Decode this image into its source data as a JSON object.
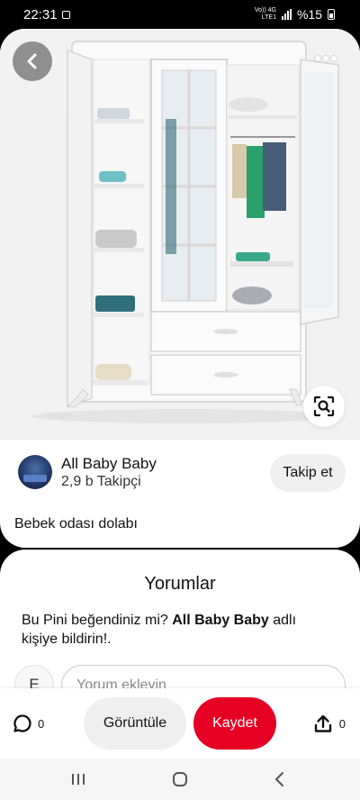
{
  "status_bar": {
    "time": "22:31",
    "network_top": "Vo)) 4G",
    "network_bottom": "LTE1",
    "battery": "%15"
  },
  "pin": {
    "image_alt": "white wardrobe",
    "creator": {
      "name": "All Baby Baby",
      "followers": "2,9 b Takipçi",
      "follow_label": "Takip et"
    },
    "description": "Bebek odası dolabı"
  },
  "comments": {
    "title": "Yorumlar",
    "prompt_before": "Bu Pini beğendiniz mi? ",
    "prompt_bold": "All Baby Baby",
    "prompt_after": " adlı kişiye bildirin!.",
    "avatar_initial": "E",
    "input_placeholder": "Yorum ekleyin"
  },
  "actions": {
    "comment_count": "0",
    "view_label": "Görüntüle",
    "save_label": "Kaydet",
    "share_count": "0"
  },
  "icons": {
    "back": "chevron-left-icon",
    "more": "more-dots-icon",
    "lens": "visual-search-icon",
    "comment": "speech-bubble-icon",
    "share": "share-icon",
    "recents": "recents-icon",
    "home": "home-icon",
    "nav_back": "nav-back-icon"
  },
  "colors": {
    "brand_red": "#e60023",
    "button_gray": "#efefef"
  }
}
